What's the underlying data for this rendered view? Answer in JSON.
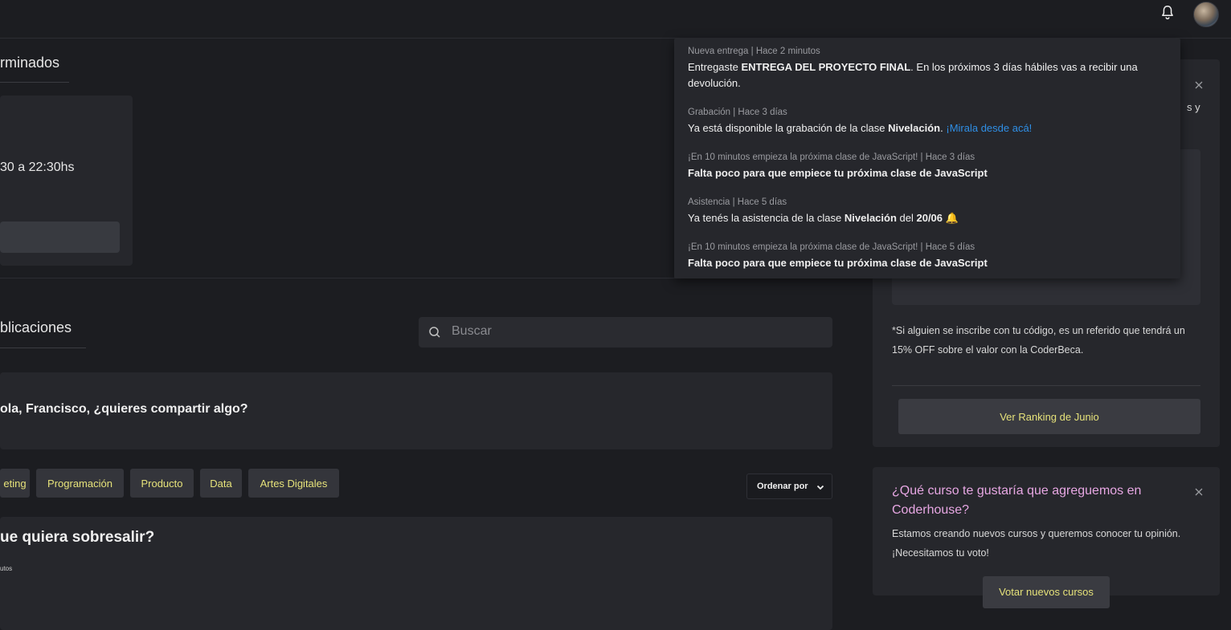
{
  "header": {
    "bell_icon": "bell-icon",
    "avatar": "user-avatar"
  },
  "classes": {
    "title": "rminados",
    "time": "30 a 22:30hs"
  },
  "publications": {
    "title": "blicaciones",
    "search_placeholder": "Buscar",
    "compose_prompt": "ola, Francisco, ¿quieres compartir algo?",
    "categories": [
      "eting",
      "Programación",
      "Producto",
      "Data",
      "Artes Digitales"
    ],
    "order_label": "Ordenar por",
    "post_title": "ue quiera sobresalir?",
    "post_sub": "utos"
  },
  "sidebar": {
    "partial_text": "s y",
    "referral_note": "*Si alguien se inscribe con tu código, es un referido que tendrá un 15% OFF sobre el valor con la CoderBeca.",
    "ranking_button": "Ver Ranking de Junio",
    "survey": {
      "title_part1": "¿Qué curso te gustaría que agreguemos en",
      "title_part2": "Coderhouse?",
      "desc": "Estamos creando nuevos cursos y queremos conocer tu opinión. ¡Necesitamos tu voto!",
      "vote_button": "Votar nuevos cursos"
    }
  },
  "notifications": [
    {
      "meta": "Nueva entrega | Hace 2 minutos",
      "pre": "Entregaste ",
      "bold1": "ENTREGA DEL PROYECTO FINAL",
      "post": ". En los próximos 3 días hábiles vas a recibir una devolución."
    },
    {
      "meta": "Grabación | Hace 3 días",
      "pre": "Ya está disponible la grabación de la clase ",
      "bold1": "Nivelación",
      "post": ". ",
      "link": "¡Miralа desde acá!"
    },
    {
      "meta": "¡En 10 minutos empieza la próxima clase de JavaScript! | Hace 3 días",
      "pre": "Falta poco para que empiece tu próxima clase de JavaScript"
    },
    {
      "meta": "Asistencia | Hace 5 días",
      "pre": "Ya tenés la asistencia de la clase ",
      "bold1": "Nivelación",
      "mid": " del ",
      "bold2": "20/06",
      "emoji": "🔔"
    },
    {
      "meta": "¡En 10 minutos empieza la próxima clase de JavaScript! | Hace 5 días",
      "pre": "Falta poco para que empiece tu próxima clase de JavaScript"
    }
  ]
}
